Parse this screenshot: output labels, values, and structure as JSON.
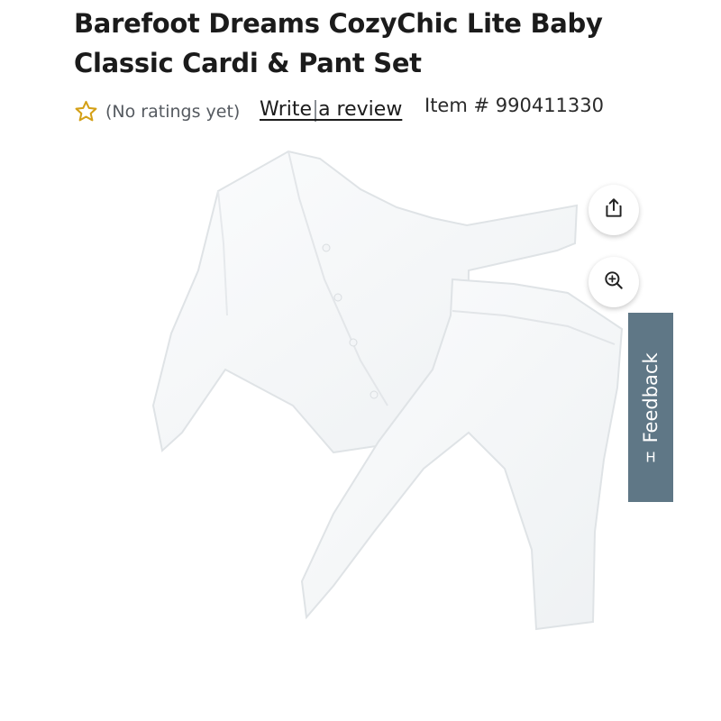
{
  "product": {
    "title_line1": "Barefoot Dreams CozyChic Lite Baby",
    "title_line2": "Classic Cardi & Pant Set",
    "ratings_text": "(No ratings yet)",
    "write_review_label": "Write a review",
    "item_number": "Item # 990411330"
  },
  "buttons": {
    "share_icon": "share-icon",
    "zoom_icon": "zoom-in-icon"
  },
  "feedback": {
    "label": "Feedback",
    "icon_glyph": "H"
  },
  "colors": {
    "star_outline": "#d4a017",
    "feedback_tab": "#5f7786"
  }
}
